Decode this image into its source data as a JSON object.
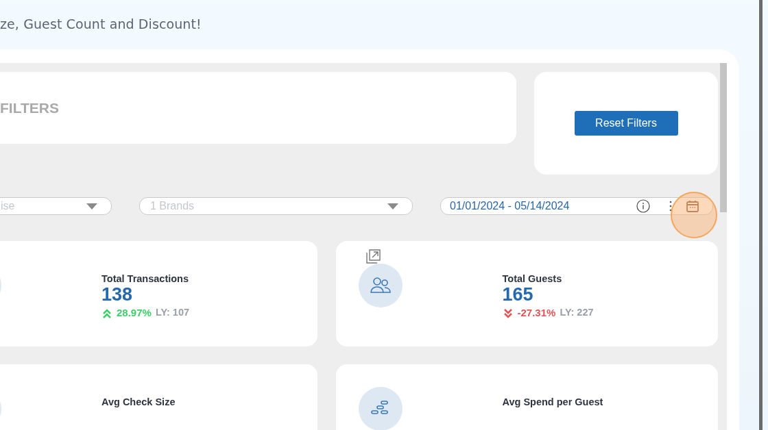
{
  "header": {
    "subtitle": "ze, Guest Count and Discount!"
  },
  "filters_card": {
    "title": "FILTERS"
  },
  "reset_button": {
    "label": "Reset Filters"
  },
  "dropdowns": [
    {
      "placeholder": "ise"
    },
    {
      "placeholder": "1 Brands"
    }
  ],
  "date_range": {
    "value": "01/01/2024 - 05/14/2024",
    "calendar_highlighted": true
  },
  "metric_cards": [
    {
      "title": "Total Transactions",
      "value": "138",
      "change": "28.97%",
      "rising": true,
      "last_year": "LY: 107"
    },
    {
      "title": "Total Guests",
      "value": "165",
      "change": "-27.31%",
      "rising": false,
      "last_year": "LY: 227",
      "expandable": true
    },
    {
      "title": "Avg Check Size"
    },
    {
      "title": "Avg Spend per Guest"
    }
  ]
}
